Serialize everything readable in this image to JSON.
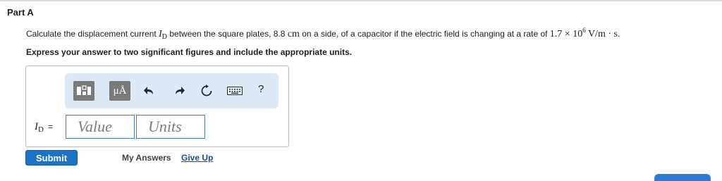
{
  "part": {
    "title": "Part A"
  },
  "question": {
    "pre": "Calculate the displacement current ",
    "symbol": "I",
    "symbol_sub": "D",
    "mid1": " between the square plates, 8.8 ",
    "unit_cm": "cm",
    "mid2": " on a side, of a capacitor if the electric field is changing at a rate of ",
    "rate_coeff": "1.7 × 10",
    "rate_exp": "6",
    "rate_unit": " V/m · s."
  },
  "instruction": "Express your answer to two significant figures and include the appropriate units.",
  "toolbar": {
    "templates_icon": "templates-icon",
    "units_label": "μÅ",
    "undo_icon": "undo-icon",
    "redo_icon": "redo-icon",
    "reset_icon": "reset-icon",
    "keyboard_icon": "keyboard-icon",
    "help_label": "?"
  },
  "answer": {
    "label_symbol": "I",
    "label_sub": "D",
    "label_eq": "=",
    "value_placeholder": "Value",
    "units_placeholder": "Units"
  },
  "actions": {
    "submit": "Submit",
    "my_answers": "My Answers",
    "give_up": "Give Up"
  },
  "colors": {
    "submit_bg": "#1a73c9",
    "toolbar_bg": "#dde9f5",
    "field_border": "#4a79b8",
    "link": "#1a4e8c"
  }
}
